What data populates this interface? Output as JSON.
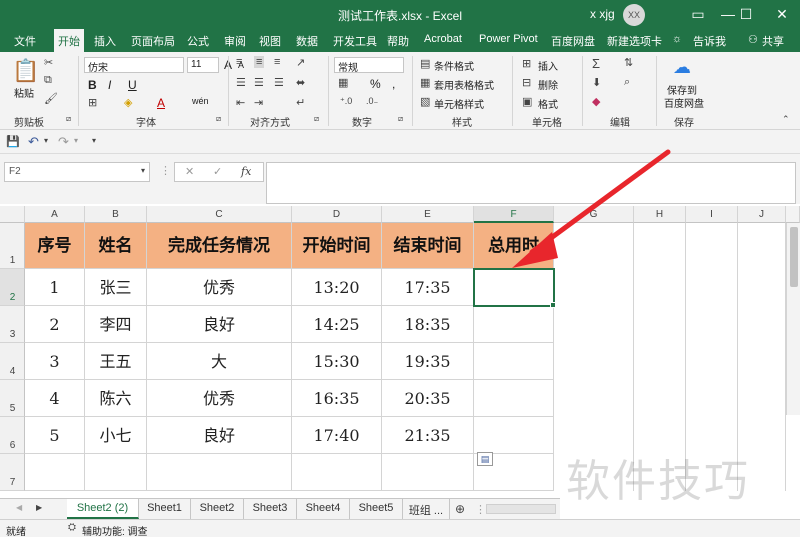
{
  "window": {
    "title": "测试工作表.xlsx - Excel",
    "user": "x xjg",
    "avatar": "XX",
    "minimize": "—",
    "restore": "☐",
    "close": "✕"
  },
  "tabs": [
    "文件",
    "开始",
    "插入",
    "页面布局",
    "公式",
    "审阅",
    "视图",
    "数据",
    "开发工具",
    "帮助",
    "Acrobat",
    "Power Pivot",
    "百度网盘",
    "新建选项卡"
  ],
  "tell_me": "告诉我",
  "share": "共享",
  "ribbon": {
    "clipboard": {
      "label": "剪贴板",
      "paste": "粘贴"
    },
    "font": {
      "label": "字体",
      "name": "仿宋",
      "size": "11",
      "bold": "B",
      "italic": "I",
      "underline": "U",
      "grow": "A",
      "shrink": "A",
      "color_letter": "A",
      "wen": "wén"
    },
    "alignment": {
      "label": "对齐方式"
    },
    "number": {
      "label": "数字",
      "format": "常规",
      "percent": "%",
      "comma": ","
    },
    "styles": {
      "label": "样式",
      "conditional": "条件格式",
      "table": "套用表格格式",
      "cell": "单元格样式"
    },
    "cells": {
      "label": "单元格",
      "insert": "插入",
      "delete": "删除",
      "format": "格式"
    },
    "editing": {
      "label": "编辑"
    },
    "save": {
      "label": "保存",
      "button_line1": "保存到",
      "button_line2": "百度网盘"
    }
  },
  "formula_bar": {
    "name_box": "F2",
    "cancel": "✕",
    "enter": "✓",
    "fx": "fx",
    "value": ""
  },
  "grid": {
    "columns": [
      "A",
      "B",
      "C",
      "D",
      "E",
      "F",
      "G",
      "H",
      "I",
      "J"
    ],
    "rows": [
      "1",
      "2",
      "3",
      "4",
      "5",
      "6",
      "7"
    ],
    "header": [
      "序号",
      "姓名",
      "完成任务情况",
      "开始时间",
      "结束时间",
      "总用时"
    ],
    "data": [
      [
        "1",
        "张三",
        "优秀",
        "13:20",
        "17:35",
        ""
      ],
      [
        "2",
        "李四",
        "良好",
        "14:25",
        "18:35",
        ""
      ],
      [
        "3",
        "王五",
        "大",
        "15:30",
        "19:35",
        ""
      ],
      [
        "4",
        "陈六",
        "优秀",
        "16:35",
        "20:35",
        ""
      ],
      [
        "5",
        "小七",
        "良好",
        "17:40",
        "21:35",
        ""
      ]
    ],
    "selected_cell": "F2",
    "header_color": "#f4b183"
  },
  "sheets": [
    "Sheet2 (2)",
    "Sheet1",
    "Sheet2",
    "Sheet3",
    "Sheet4",
    "Sheet5",
    "班组 ..."
  ],
  "active_sheet": "Sheet2 (2)",
  "status": {
    "mode": "就绪",
    "accessibility": "辅助功能: 调查"
  },
  "watermark": "软件技巧",
  "accent_color": "#217346",
  "arrow_color": "#e8262c"
}
